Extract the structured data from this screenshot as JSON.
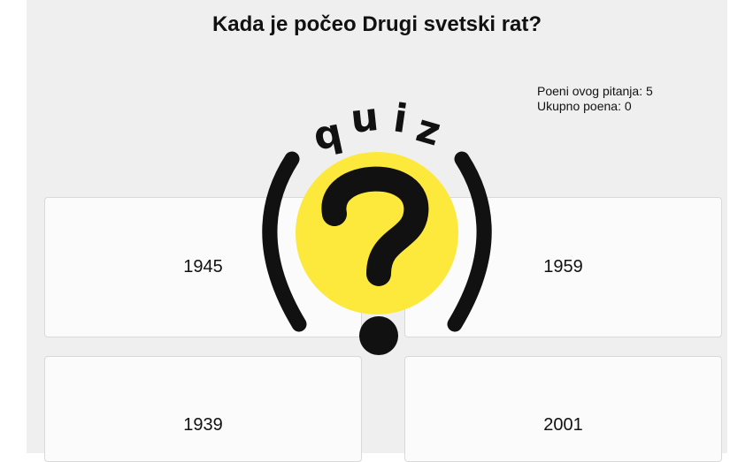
{
  "question": {
    "text": "Kada je počeo Drugi svetski rat?"
  },
  "score": {
    "question_points": "Poeni ovog pitanja: 5",
    "total_points": "Ukupno poena: 0"
  },
  "answers": [
    {
      "label": "1945"
    },
    {
      "label": "1959"
    },
    {
      "label": "1939"
    },
    {
      "label": "2001"
    }
  ],
  "logo": {
    "text": "quiz",
    "icon": "question-mark-icon",
    "colors": {
      "circle": "#fde93c",
      "ink": "#111111"
    }
  }
}
